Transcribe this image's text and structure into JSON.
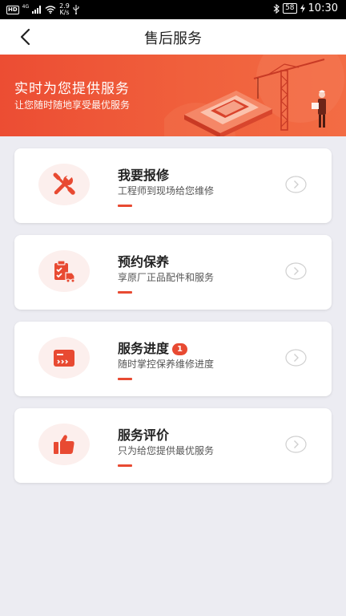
{
  "status_bar": {
    "hd": "HD",
    "network": "4G",
    "speed_value": "2.9",
    "speed_unit": "K/s",
    "battery": "58",
    "time": "10:30"
  },
  "nav": {
    "title": "售后服务"
  },
  "banner": {
    "title": "实时为您提供服务",
    "subtitle": "让您随时随地享受最优服务"
  },
  "services": [
    {
      "title": "我要报修",
      "desc": "工程师到现场给您维修",
      "icon": "wrench-screwdriver-icon"
    },
    {
      "title": "预约保养",
      "desc": "享原厂正品配件和服务",
      "icon": "clipboard-truck-icon"
    },
    {
      "title": "服务进度",
      "desc": "随时掌控保养维修进度",
      "badge": "1",
      "icon": "progress-card-icon"
    },
    {
      "title": "服务评价",
      "desc": "只为给您提供最优服务",
      "icon": "thumbs-up-icon"
    }
  ],
  "colors": {
    "accent": "#e84a32",
    "banner_start": "#ec4d33",
    "banner_end": "#f36c44",
    "background": "#ececf2",
    "icon_bg": "#fcefed"
  }
}
